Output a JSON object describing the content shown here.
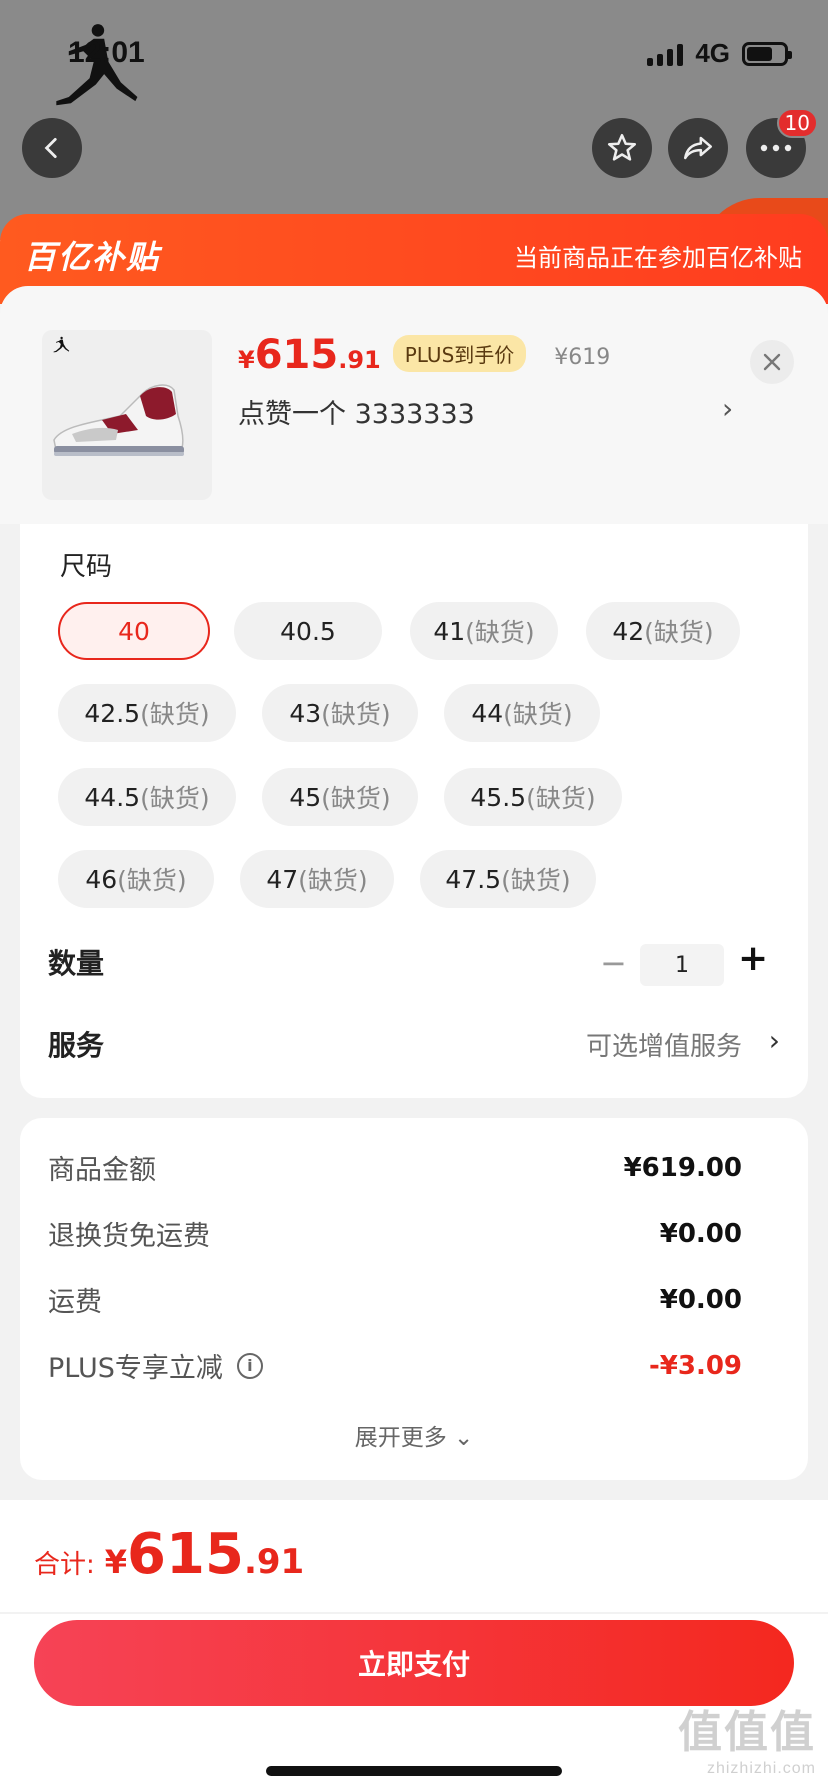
{
  "status_bar": {
    "time": "12:01",
    "network": "4G"
  },
  "nav": {
    "cart_badge": "10"
  },
  "banner": {
    "logo": "百亿补贴",
    "text": "当前商品正在参加百亿补贴"
  },
  "product": {
    "price_symbol": "¥",
    "price_int": "615",
    "price_dec": ".91",
    "plus_tag": "PLUS到手价",
    "original_price": "¥619",
    "name": "点赞一个  3333333",
    "chevron": "›"
  },
  "size": {
    "title": "尺码",
    "options": [
      {
        "size": "40",
        "note": ""
      },
      {
        "size": "40.5",
        "note": ""
      },
      {
        "size": "41",
        "note": "(缺货)"
      },
      {
        "size": "42",
        "note": "(缺货)"
      },
      {
        "size": "42.5",
        "note": "(缺货)"
      },
      {
        "size": "43",
        "note": "(缺货)"
      },
      {
        "size": "44",
        "note": "(缺货)"
      },
      {
        "size": "44.5",
        "note": "(缺货)"
      },
      {
        "size": "45",
        "note": "(缺货)"
      },
      {
        "size": "45.5",
        "note": "(缺货)"
      },
      {
        "size": "46",
        "note": "(缺货)"
      },
      {
        "size": "47",
        "note": "(缺货)"
      },
      {
        "size": "47.5",
        "note": "(缺货)"
      }
    ]
  },
  "quantity": {
    "label": "数量",
    "minus": "−",
    "value": "1",
    "plus": "+"
  },
  "service": {
    "label": "服务",
    "value": "可选增值服务",
    "chevron": "›"
  },
  "costs": {
    "rows": [
      {
        "label": "商品金额",
        "value": "¥619.00"
      },
      {
        "label": "退换货免运费",
        "value": "¥0.00"
      },
      {
        "label": "运费",
        "value": "¥0.00"
      },
      {
        "label": "PLUS专享立减",
        "value": "-¥3.09"
      }
    ],
    "expand": "展开更多 ⌄"
  },
  "footer": {
    "total_label": "合计:",
    "total_symbol": "¥",
    "total_int": "615",
    "total_dec": ".91",
    "pay_button": "立即支付"
  },
  "watermark": {
    "big": "值值值",
    "small": "zhizhizhi.com"
  },
  "colors": {
    "accent": "#e8271c",
    "banner": "#ff5a1f",
    "plus_tag_bg": "#fbe6a6"
  }
}
